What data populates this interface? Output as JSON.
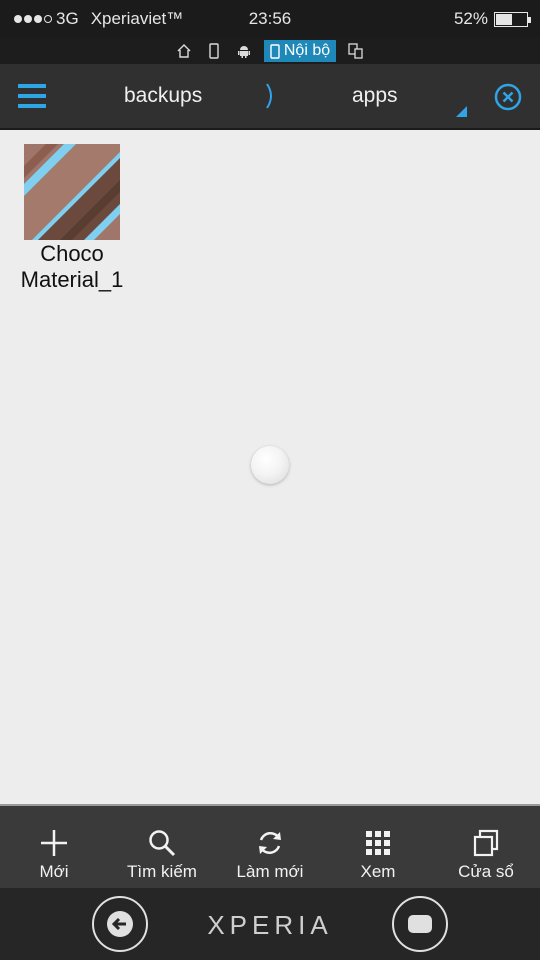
{
  "status_bar": {
    "network": "3G",
    "carrier": "Xperiaviet™",
    "time": "23:56",
    "battery_percent_text": "52%",
    "battery_level": 0.52
  },
  "storage_bar": {
    "icons": [
      "home-icon",
      "phone-icon",
      "android-icon",
      "internal-storage-icon",
      "storage-transfer-icon"
    ],
    "active_label": "Nội bộ"
  },
  "toolbar": {
    "breadcrumbs": [
      "backups",
      "apps"
    ],
    "accent_color": "#2fa4e7"
  },
  "files": [
    {
      "name_line1": "Choco",
      "name_line2": "Material_1",
      "icon": "choco-material-app-icon"
    }
  ],
  "actions": [
    {
      "label": "Mới",
      "icon": "plus-icon"
    },
    {
      "label": "Tìm kiếm",
      "icon": "search-icon"
    },
    {
      "label": "Làm mới",
      "icon": "refresh-icon"
    },
    {
      "label": "Xem",
      "icon": "grid-view-icon"
    },
    {
      "label": "Cửa sổ",
      "icon": "windows-icon"
    }
  ],
  "nav_bar": {
    "brand": "XPERIA"
  }
}
